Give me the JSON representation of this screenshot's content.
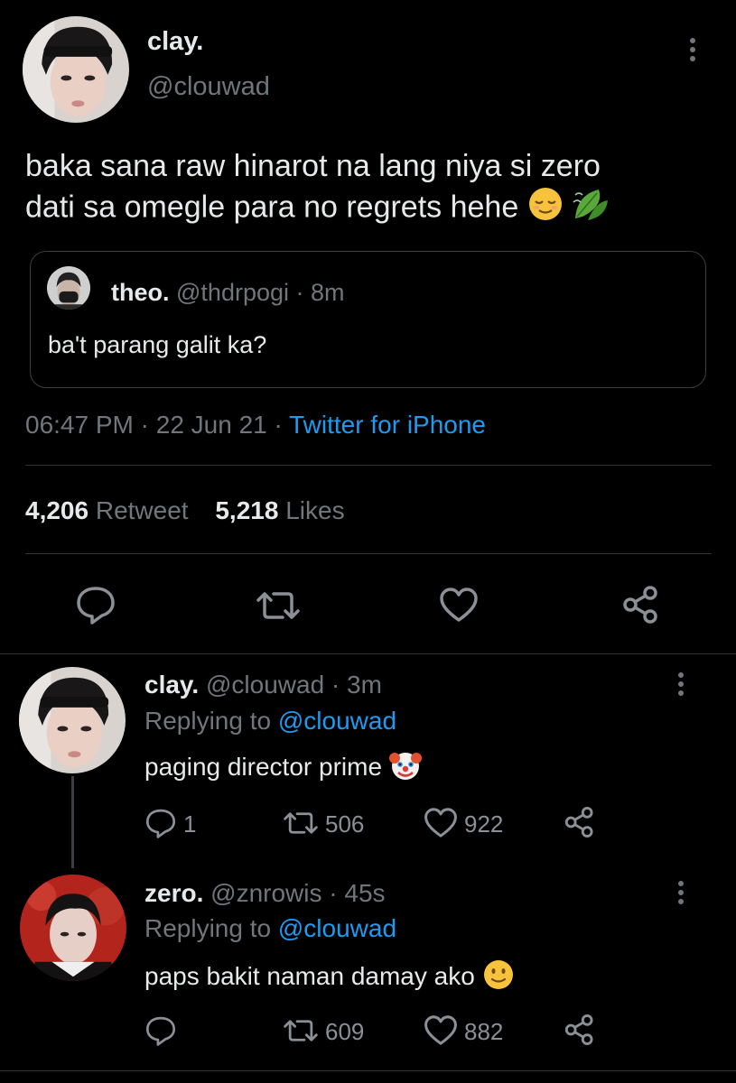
{
  "main_tweet": {
    "author_name": "clay.",
    "author_handle": "@clouwad",
    "text": "baka sana raw hinarot na lang niya si zero dati sa omegle para no regrets hehe",
    "text_line1": "baka sana raw hinarot na lang niya si zero",
    "text_line2": "dati sa omegle para no regrets hehe",
    "emojis": [
      "relieved-face",
      "leaf-fluttering-in-wind"
    ],
    "quoted": {
      "author_name": "theo.",
      "author_handle": "@thdrpogi",
      "time": "· 8m",
      "text": "ba't parang galit ka?"
    },
    "time": "06:47 PM",
    "date": "· 22 Jun 21 ·",
    "source": "Twitter for iPhone",
    "retweets_count": "4,206",
    "retweets_label": "Retweet",
    "likes_count": "5,218",
    "likes_label": "Likes"
  },
  "replies": [
    {
      "author_name": "clay.",
      "author_handle": "@clouwad",
      "time": "· 3m",
      "replying_prefix": "Replying to",
      "replying_to": "@clouwad",
      "text": "paging director prime",
      "emoji": "clown-face",
      "reply_count": "1",
      "retweet_count": "506",
      "like_count": "922"
    },
    {
      "author_name": "zero.",
      "author_handle": "@znrowis",
      "time": "· 45s",
      "replying_prefix": "Replying to",
      "replying_to": "@clouwad",
      "text": "paps bakit naman damay ako",
      "emoji": "slightly-smiling-face",
      "reply_count": "",
      "retweet_count": "609",
      "like_count": "882"
    }
  ],
  "colors": {
    "background": "#000000",
    "text": "#e7e9ea",
    "muted": "#71767b",
    "link": "#1d9bf0",
    "divider": "#2f3336"
  }
}
